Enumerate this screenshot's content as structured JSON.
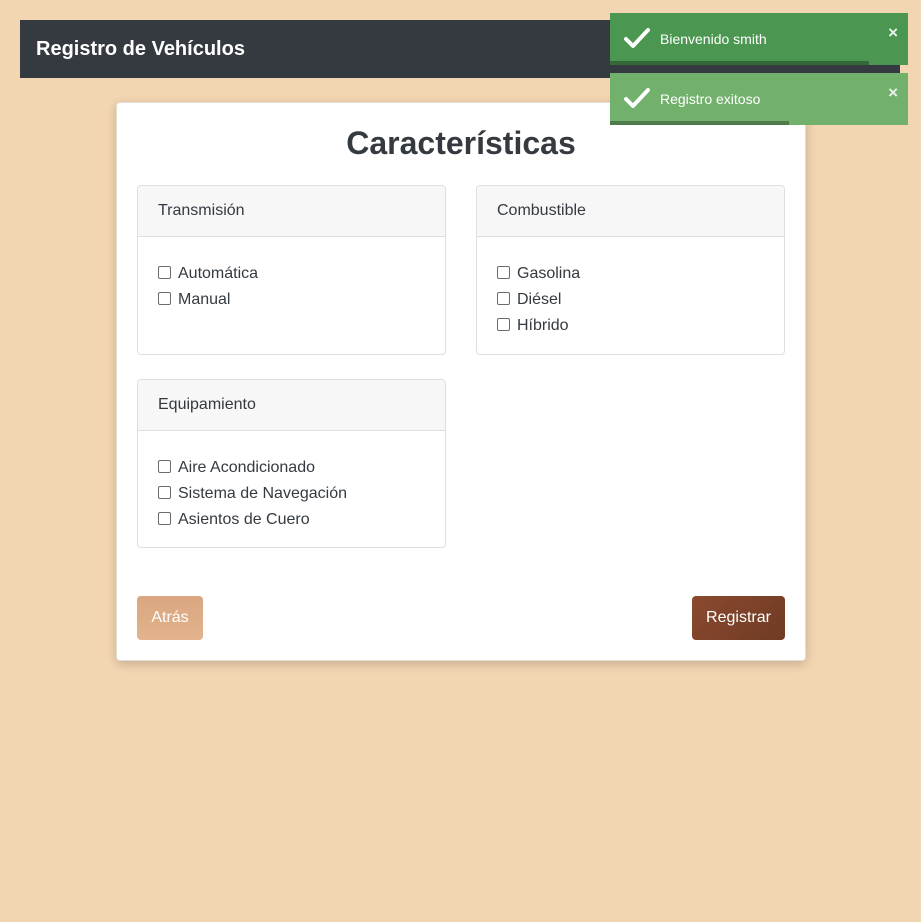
{
  "navbar": {
    "brand": "Registro de Vehículos"
  },
  "form": {
    "title": "Características",
    "groups": [
      {
        "title": "Transmisión",
        "options": [
          "Automática",
          "Manual"
        ]
      },
      {
        "title": "Combustible",
        "options": [
          "Gasolina",
          "Diésel",
          "Híbrido"
        ]
      },
      {
        "title": "Equipamiento",
        "options": [
          "Aire Acondicionado",
          "Sistema de Navegación",
          "Asientos de Cuero"
        ]
      }
    ],
    "back_label": "Atrás",
    "submit_label": "Registrar"
  },
  "toasts": [
    {
      "message": "Bienvenido smith",
      "close": "×",
      "progress": 0.87,
      "color": "#4b9650"
    },
    {
      "message": "Registro exitoso",
      "close": "×",
      "progress": 0.6,
      "color": "#72b16b"
    }
  ]
}
